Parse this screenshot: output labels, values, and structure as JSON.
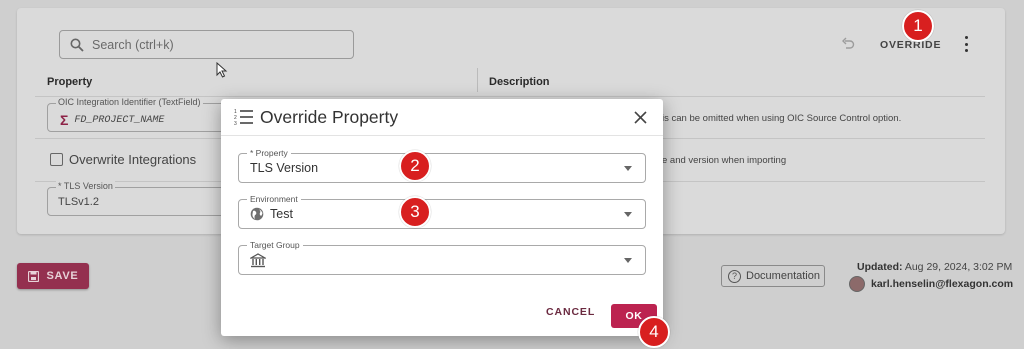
{
  "search": {
    "placeholder": "Search (ctrl+k)"
  },
  "toolbar": {
    "override_label": "OVERRIDE"
  },
  "table": {
    "headers": {
      "property": "Property",
      "description": "Description"
    },
    "rows": [
      {
        "legend": "OIC Integration Identifier (TextField)",
        "value": "FD_PROJECT_NAME",
        "description_fragment": "is can be omitted when using OIC Source Control option."
      },
      {
        "checkbox_label": "Overwrite Integrations",
        "description_fragment": "e and version when importing"
      },
      {
        "legend": "* TLS Version",
        "value": "TLSv1.2"
      }
    ]
  },
  "footer": {
    "save_label": "SAVE",
    "documentation_label": "Documentation",
    "updated_label": "Updated:",
    "updated_value": "Aug 29, 2024, 3:02 PM",
    "user": "karl.henselin@flexagon.com"
  },
  "dialog": {
    "title": "Override Property",
    "fields": [
      {
        "legend": "* Property",
        "value": "TLS Version"
      },
      {
        "legend": "Environment",
        "value": "Test"
      },
      {
        "legend": "Target Group",
        "value": ""
      }
    ],
    "cancel_label": "CANCEL",
    "ok_label": "OK"
  },
  "callouts": [
    "1",
    "2",
    "3",
    "4"
  ],
  "colors": {
    "primary": "#bc2350",
    "callout": "#d81f1f"
  }
}
